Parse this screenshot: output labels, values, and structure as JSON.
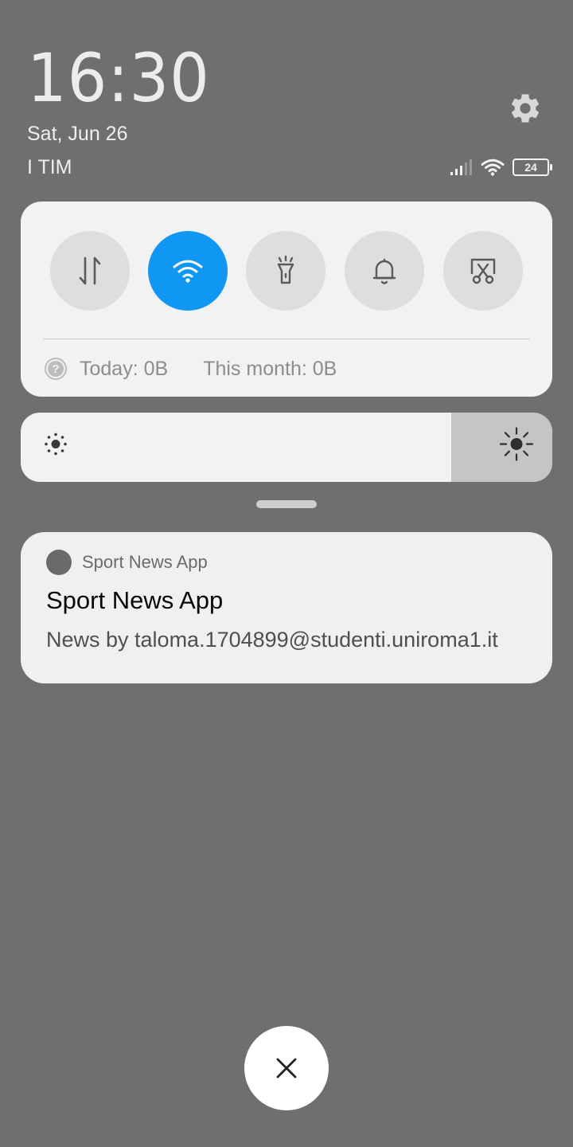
{
  "status": {
    "time": "16:30",
    "date": "Sat, Jun 26",
    "carrier": "I TIM",
    "battery": "24",
    "icons": [
      "signal-icon",
      "wifi-icon",
      "battery-icon"
    ]
  },
  "quick_settings": {
    "toggles": [
      {
        "name": "mobile-data",
        "icon": "data-transfer-icon",
        "active": false
      },
      {
        "name": "wifi",
        "icon": "wifi-icon",
        "active": true
      },
      {
        "name": "flashlight",
        "icon": "flashlight-icon",
        "active": false
      },
      {
        "name": "sound",
        "icon": "bell-icon",
        "active": false
      },
      {
        "name": "screenshot",
        "icon": "screenshot-icon",
        "active": false
      }
    ],
    "today_label": "Today: 0B",
    "month_label": "This month: 0B"
  },
  "brightness": {
    "level": 0.81
  },
  "notification": {
    "app_name": "Sport News App",
    "title": "Sport News App",
    "body": "News by taloma.1704899@studenti.uniroma1.it"
  },
  "colors": {
    "background": "#6f6f6f",
    "accent": "#0f97f3",
    "panel": "#f2f2f2"
  }
}
